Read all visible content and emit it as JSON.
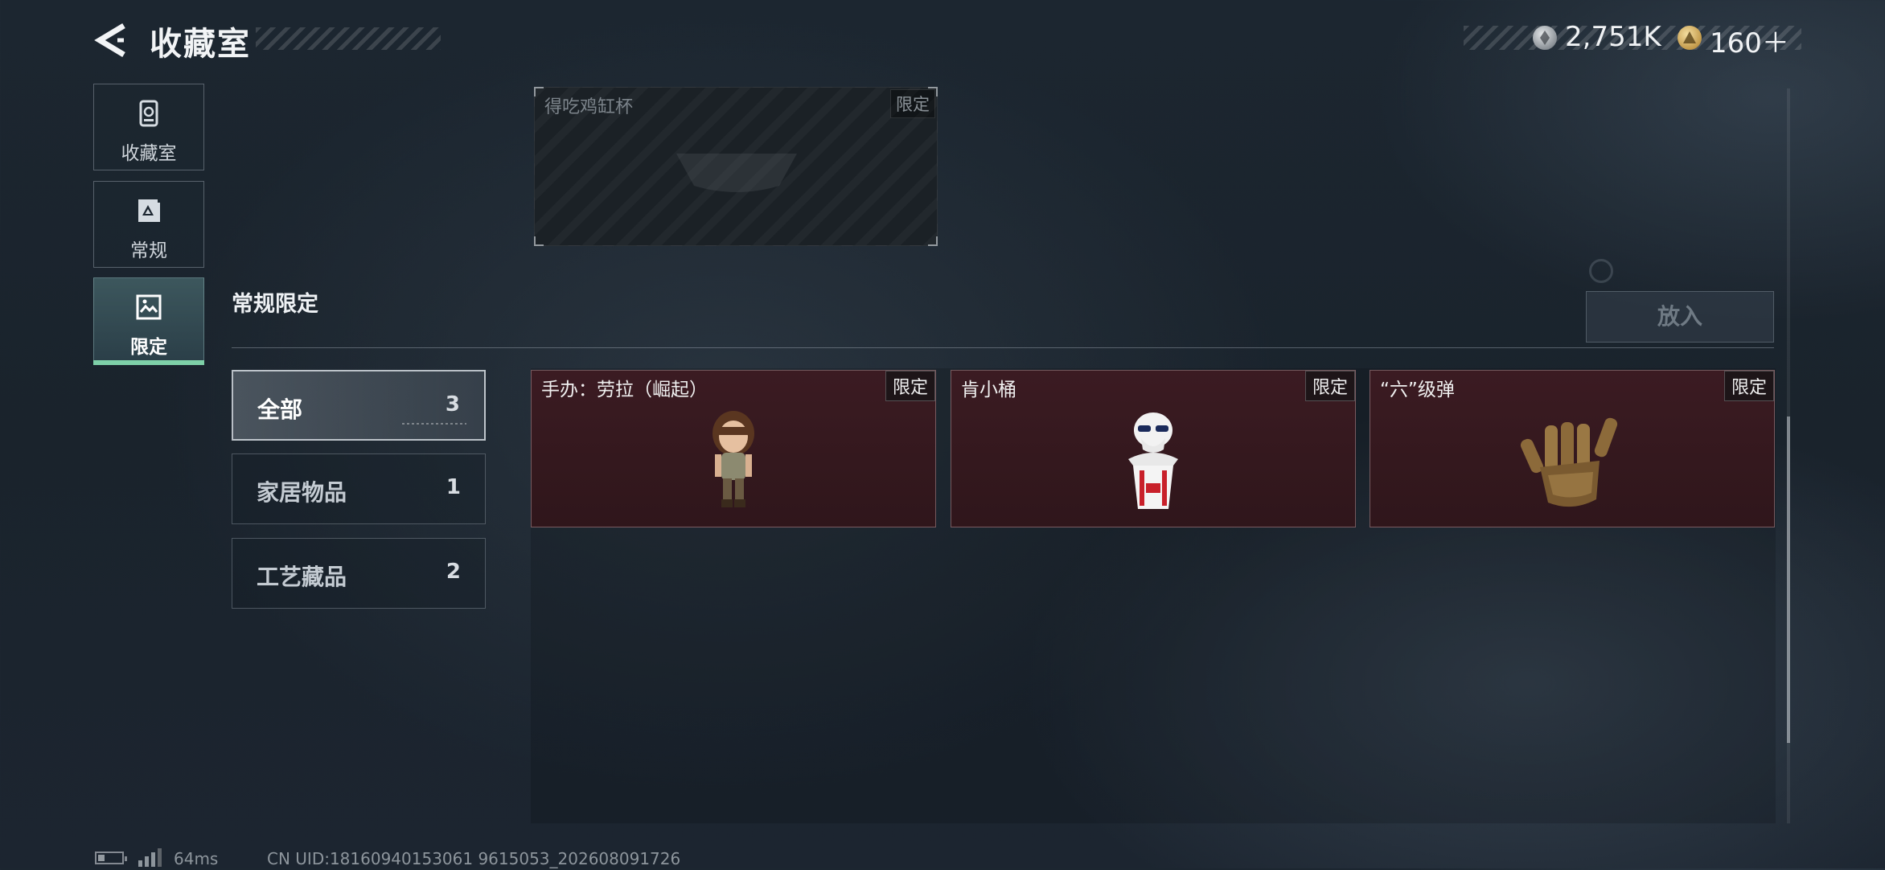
{
  "header": {
    "title": "收藏室",
    "currency1_value": "2,751K",
    "currency2_value": "160＋"
  },
  "nav": [
    {
      "label": "收藏室",
      "icon": "trophy-cabinet-icon"
    },
    {
      "label": "常规",
      "icon": "document-triangle-icon"
    },
    {
      "label": "限定",
      "icon": "image-frame-icon",
      "selected": true
    }
  ],
  "top_card": {
    "name": "得吃鸡缸杯",
    "tag": "限定"
  },
  "section": {
    "title": "常规限定",
    "put_button": "放入"
  },
  "filters": [
    {
      "label": "全部",
      "count": "3",
      "selected": true
    },
    {
      "label": "家居物品",
      "count": "1"
    },
    {
      "label": "工艺藏品",
      "count": "2"
    }
  ],
  "items": [
    {
      "name": "手办：劳拉（崛起）",
      "tag": "限定",
      "icon": "lara-figure-icon"
    },
    {
      "name": "肯小桶",
      "tag": "限定",
      "icon": "colonel-bucket-icon"
    },
    {
      "name": "“六”级弹",
      "tag": "限定",
      "icon": "bullet-hand-icon"
    }
  ],
  "footer": {
    "ping": "64ms",
    "uid": "CN UID:18160940153061 9615053_202608091726"
  },
  "colors": {
    "accent": "#7ed0a8",
    "card_bg": "#3b1b22"
  }
}
